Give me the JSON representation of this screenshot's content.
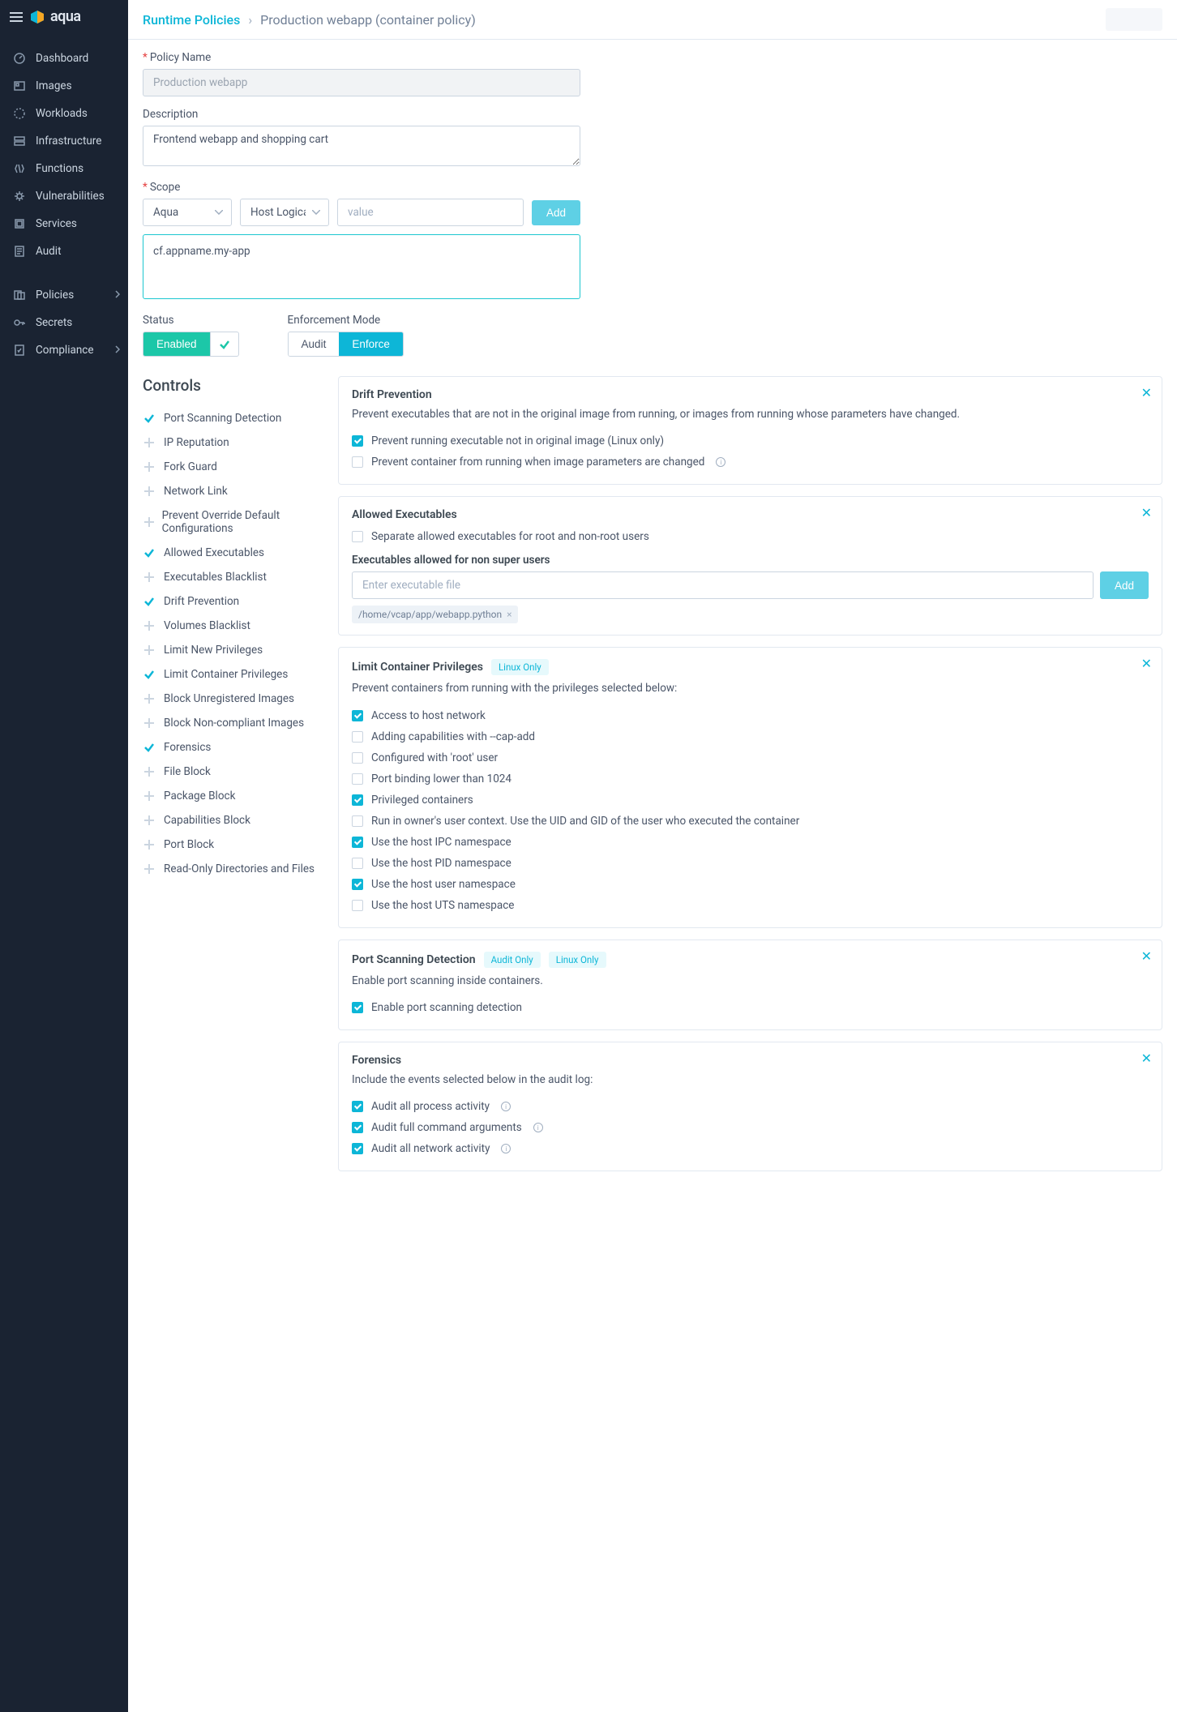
{
  "brand": {
    "name": "aqua"
  },
  "sidebar": {
    "items": [
      {
        "label": "Dashboard",
        "icon": "dashboard"
      },
      {
        "label": "Images",
        "icon": "images"
      },
      {
        "label": "Workloads",
        "icon": "workloads"
      },
      {
        "label": "Infrastructure",
        "icon": "infrastructure"
      },
      {
        "label": "Functions",
        "icon": "functions"
      },
      {
        "label": "Vulnerabilities",
        "icon": "vulnerabilities"
      },
      {
        "label": "Services",
        "icon": "services"
      },
      {
        "label": "Audit",
        "icon": "audit"
      }
    ],
    "items2": [
      {
        "label": "Policies",
        "icon": "policies",
        "expandable": true
      },
      {
        "label": "Secrets",
        "icon": "secrets"
      },
      {
        "label": "Compliance",
        "icon": "compliance",
        "expandable": true
      }
    ]
  },
  "breadcrumb": {
    "root": "Runtime Policies",
    "current": "Production webapp (container policy)"
  },
  "form": {
    "policy_name_label": "Policy Name",
    "policy_name_value": "Production webapp",
    "description_label": "Description",
    "description_value": "Frontend webapp and shopping cart",
    "scope_label": "Scope",
    "scope_select1": "Aqua",
    "scope_select2": "Host Logical N",
    "scope_value_placeholder": "value",
    "scope_add": "Add",
    "scope_tag": "cf.appname.my-app",
    "status_label": "Status",
    "status_enabled": "Enabled",
    "enforcement_label": "Enforcement Mode",
    "enforcement_audit": "Audit",
    "enforcement_enforce": "Enforce"
  },
  "controls": {
    "title": "Controls",
    "items": [
      {
        "label": "Port Scanning Detection",
        "active": true
      },
      {
        "label": "IP Reputation",
        "active": false
      },
      {
        "label": "Fork Guard",
        "active": false
      },
      {
        "label": "Network Link",
        "active": false
      },
      {
        "label": "Prevent Override Default Configurations",
        "active": false
      },
      {
        "label": "Allowed Executables",
        "active": true
      },
      {
        "label": "Executables Blacklist",
        "active": false
      },
      {
        "label": "Drift Prevention",
        "active": true
      },
      {
        "label": "Volumes Blacklist",
        "active": false
      },
      {
        "label": "Limit New Privileges",
        "active": false
      },
      {
        "label": "Limit Container Privileges",
        "active": true
      },
      {
        "label": "Block Unregistered Images",
        "active": false
      },
      {
        "label": "Block Non-compliant Images",
        "active": false
      },
      {
        "label": "Forensics",
        "active": true
      },
      {
        "label": "File Block",
        "active": false
      },
      {
        "label": "Package Block",
        "active": false
      },
      {
        "label": "Capabilities Block",
        "active": false
      },
      {
        "label": "Port Block",
        "active": false
      },
      {
        "label": "Read-Only Directories and Files",
        "active": false
      }
    ]
  },
  "cards": {
    "drift": {
      "title": "Drift Prevention",
      "desc": "Prevent executables that are not in the original image from running, or images from running whose parameters have changed.",
      "opts": [
        {
          "label": "Prevent running executable not in original image (Linux only)",
          "checked": true
        },
        {
          "label": "Prevent container from running when image parameters are changed",
          "checked": false,
          "info": true
        }
      ]
    },
    "allowed": {
      "title": "Allowed Executables",
      "sep_label": "Separate allowed executables for root and non-root users",
      "sub": "Executables allowed for non super users",
      "placeholder": "Enter executable file",
      "add": "Add",
      "chip": "/home/vcap/app/webapp.python"
    },
    "limit": {
      "title": "Limit Container Privileges",
      "badge": "Linux Only",
      "desc": "Prevent containers from running with the privileges selected below:",
      "opts": [
        {
          "label": "Access to host network",
          "checked": true
        },
        {
          "label": "Adding capabilities with --cap-add",
          "checked": false
        },
        {
          "label": "Configured with 'root' user",
          "checked": false
        },
        {
          "label": "Port binding lower than 1024",
          "checked": false
        },
        {
          "label": "Privileged containers",
          "checked": true
        },
        {
          "label": "Run in owner's user context. Use the UID and GID of the user who executed the container",
          "checked": false
        },
        {
          "label": "Use the host IPC namespace",
          "checked": true
        },
        {
          "label": "Use the host PID namespace",
          "checked": false
        },
        {
          "label": "Use the host user namespace",
          "checked": true
        },
        {
          "label": "Use the host UTS namespace",
          "checked": false
        }
      ]
    },
    "port": {
      "title": "Port Scanning Detection",
      "badge1": "Audit Only",
      "badge2": "Linux Only",
      "desc": "Enable port scanning inside containers.",
      "opt": "Enable port scanning detection"
    },
    "forensics": {
      "title": "Forensics",
      "desc": "Include the events selected below in the audit log:",
      "opts": [
        {
          "label": "Audit all process activity",
          "checked": true,
          "info": true
        },
        {
          "label": "Audit full command arguments",
          "checked": true,
          "info": true
        },
        {
          "label": "Audit all network activity",
          "checked": true,
          "info": true
        }
      ]
    }
  }
}
